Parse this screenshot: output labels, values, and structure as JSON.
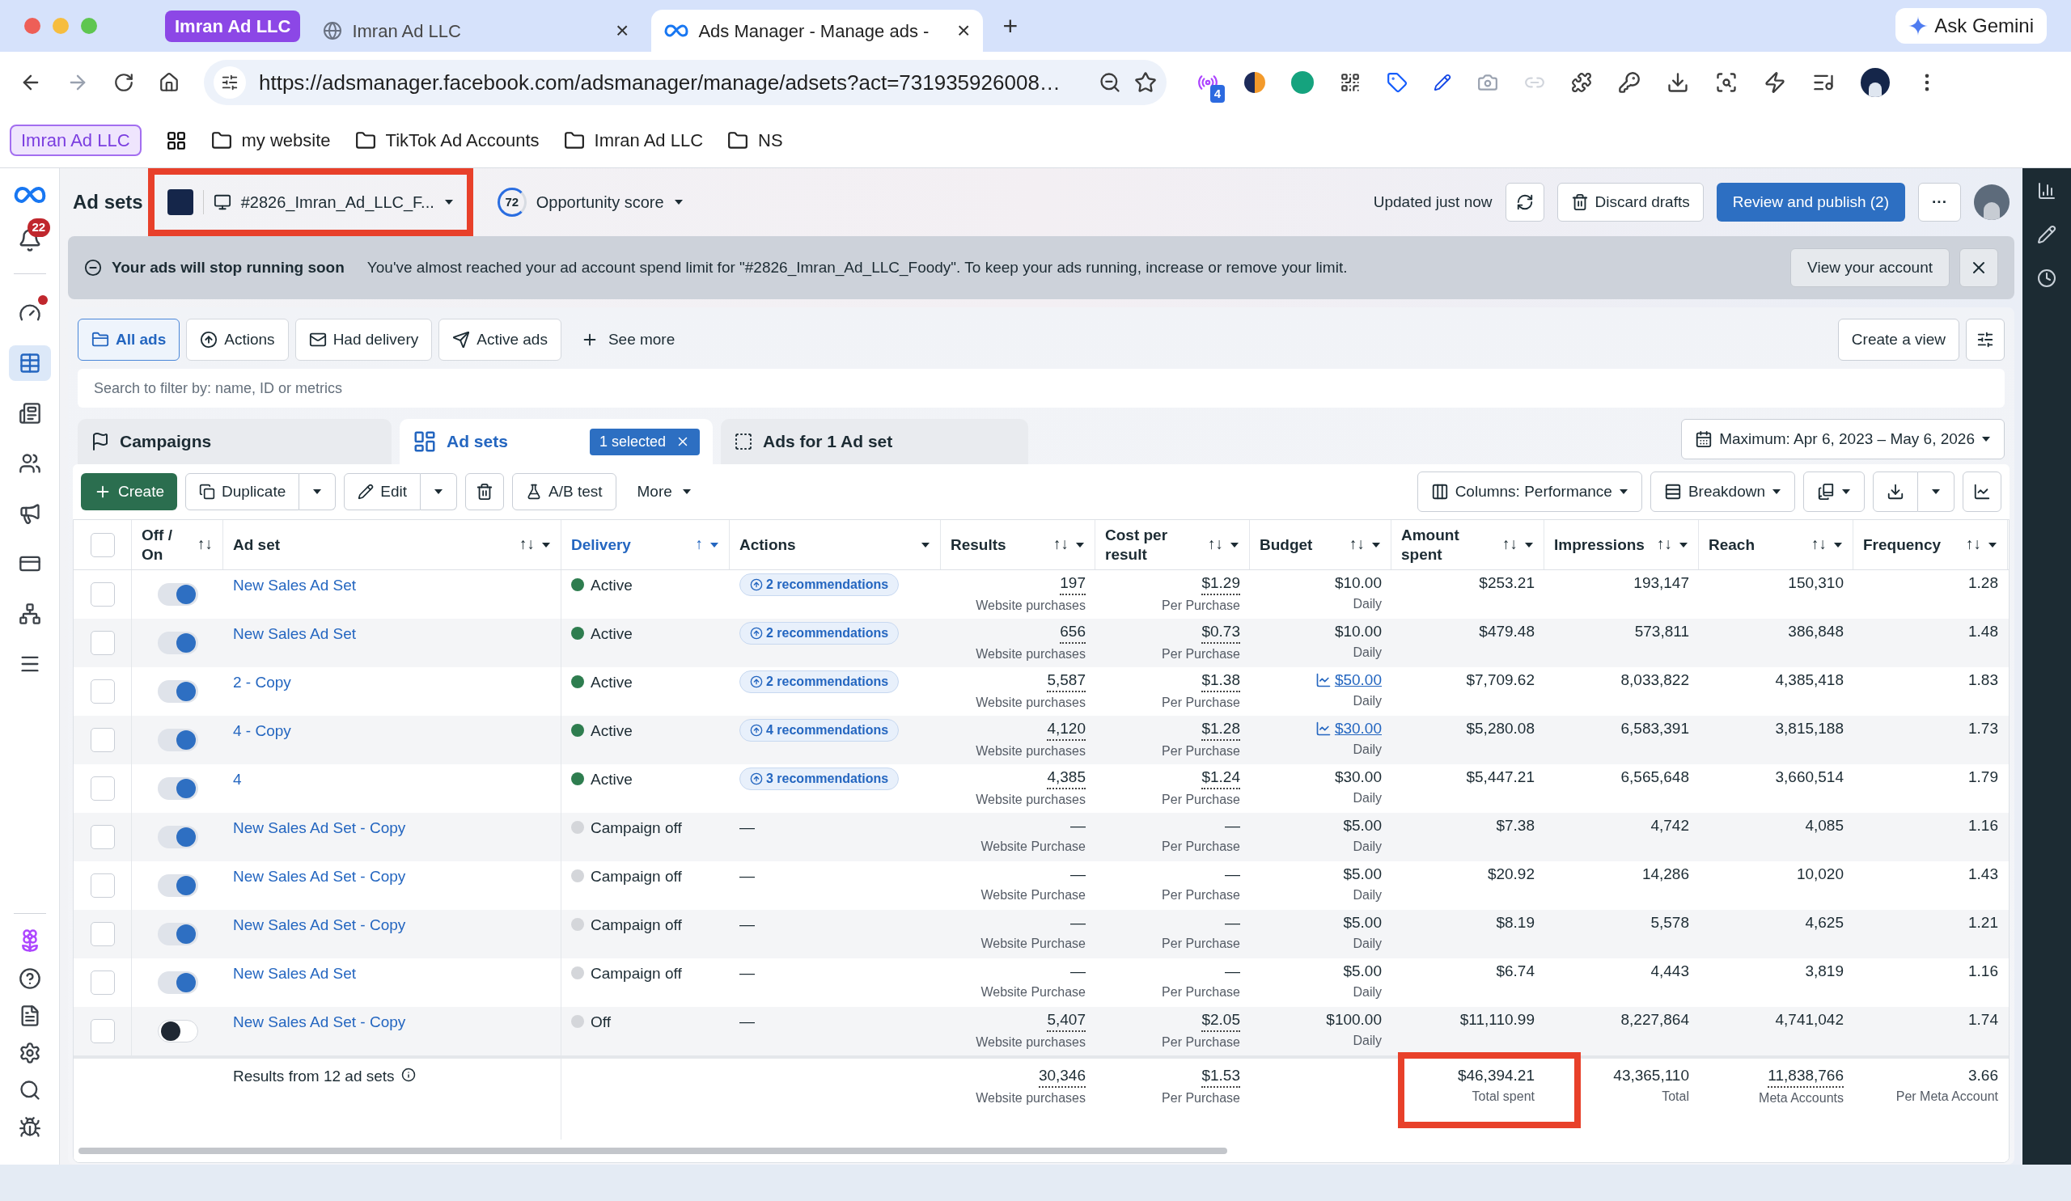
{
  "browser": {
    "tabs": [
      {
        "kind": "group",
        "label": "Imran Ad LLC"
      },
      {
        "kind": "page",
        "label": "Imran Ad LLC",
        "selected": false,
        "close": "×"
      },
      {
        "kind": "page",
        "label": "Ads Manager - Manage ads -",
        "selected": true,
        "close": "×"
      }
    ],
    "new_tab": "+",
    "gemini": "Ask Gemini",
    "url": "https://adsmanager.facebook.com/adsmanager/manage/adsets?act=731935926008…",
    "extension_badge": "4",
    "bookmarks": [
      {
        "kind": "group",
        "label": "Imran Ad LLC"
      },
      {
        "kind": "apps"
      },
      {
        "kind": "folder",
        "label": "my website"
      },
      {
        "kind": "folder",
        "label": "TikTok Ad Accounts"
      },
      {
        "kind": "folder",
        "label": "Imran Ad LLC"
      },
      {
        "kind": "folder",
        "label": "NS"
      }
    ]
  },
  "sidebar": {
    "notifications": "22",
    "items": [
      {
        "selected": false,
        "alert": true
      },
      {
        "selected": true,
        "alert": false
      },
      {
        "selected": false,
        "alert": false
      },
      {
        "selected": false,
        "alert": false
      },
      {
        "selected": false,
        "alert": false
      },
      {
        "selected": false,
        "alert": false
      },
      {
        "selected": false,
        "alert": false
      },
      {
        "selected": false,
        "alert": false
      }
    ]
  },
  "header": {
    "title": "Ad sets",
    "account": {
      "label": "#2826_Imran_Ad_LLC_F...",
      "highlighted": true
    },
    "score": "72",
    "score_label": "Opportunity score",
    "updated": "Updated just now",
    "discard": "Discard drafts",
    "publish": "Review and publish (2)",
    "more": "···"
  },
  "banner": {
    "title": "Your ads will stop running soon",
    "text": "You've almost reached your ad account spend limit for \"#2826_Imran_Ad_LLC_Foody\". To keep your ads running, increase or remove your limit.",
    "button": "View your account"
  },
  "filters": [
    {
      "label": "All ads",
      "selected": true
    },
    {
      "label": "Actions",
      "selected": false
    },
    {
      "label": "Had delivery",
      "selected": false
    },
    {
      "label": "Active ads",
      "selected": false
    }
  ],
  "see_more": "See more",
  "create_view": "Create a view",
  "search": {
    "placeholder": "Search to filter by: name, ID or metrics"
  },
  "levels": [
    {
      "label": "Campaigns",
      "selected": false
    },
    {
      "label": "Ad sets",
      "selected": true,
      "badge": "1 selected"
    },
    {
      "label": "Ads for 1 Ad set",
      "selected": false
    }
  ],
  "date_range": "Maximum: Apr 6, 2023 – May 6, 2026",
  "toolbar": {
    "create": "Create",
    "duplicate": "Duplicate",
    "edit": "Edit",
    "ab_test": "A/B test",
    "more": "More",
    "columns": "Columns: Performance",
    "breakdown": "Breakdown"
  },
  "table": {
    "all_checked": false,
    "columns": [
      {
        "label": "Off / On",
        "sort": "↑↓",
        "menu": false,
        "active": false
      },
      {
        "label": "Ad set",
        "sort": "↑↓",
        "menu": true,
        "active": false
      },
      {
        "label": "Delivery",
        "sort": "↑",
        "menu": true,
        "active": true
      },
      {
        "label": "Actions",
        "menu": true,
        "active": false
      },
      {
        "label": "Results",
        "sort": "↑↓",
        "menu": true,
        "active": false
      },
      {
        "label": "Cost per result",
        "sort": "↑↓",
        "menu": true,
        "active": false
      },
      {
        "label": "Budget",
        "sort": "↑↓",
        "menu": true,
        "active": false
      },
      {
        "label": "Amount spent",
        "sort": "↑↓",
        "menu": true,
        "active": false
      },
      {
        "label": "Impressions",
        "sort": "↑↓",
        "menu": true,
        "active": false
      },
      {
        "label": "Reach",
        "sort": "↑↓",
        "menu": true,
        "active": false
      },
      {
        "label": "Frequency",
        "sort": "↑↓",
        "menu": true,
        "active": false
      }
    ],
    "rows": [
      {
        "checked": false,
        "on": true,
        "name": "New Sales Ad Set",
        "delivery": "Active",
        "color": "#2e7d4f",
        "action": "2 recommendations",
        "results": "197",
        "results_label": "Website purchases",
        "cost": "$1.29",
        "cost_label": "Per Purchase",
        "budget": "$10.00",
        "budget_linked": false,
        "budget_label": "Daily",
        "spent": "$253.21",
        "impressions": "193,147",
        "reach": "150,310",
        "frequency": "1.28"
      },
      {
        "checked": false,
        "on": true,
        "name": "New Sales Ad Set",
        "delivery": "Active",
        "color": "#2e7d4f",
        "action": "2 recommendations",
        "results": "656",
        "results_label": "Website purchases",
        "cost": "$0.73",
        "cost_label": "Per Purchase",
        "budget": "$10.00",
        "budget_linked": false,
        "budget_label": "Daily",
        "spent": "$479.48",
        "impressions": "573,811",
        "reach": "386,848",
        "frequency": "1.48"
      },
      {
        "checked": false,
        "on": true,
        "name": "2 - Copy",
        "delivery": "Active",
        "color": "#2e7d4f",
        "action": "2 recommendations",
        "results": "5,587",
        "results_label": "Website purchases",
        "cost": "$1.38",
        "cost_label": "Per Purchase",
        "budget": "$50.00",
        "budget_linked": true,
        "budget_label": "Daily",
        "spent": "$7,709.62",
        "impressions": "8,033,822",
        "reach": "4,385,418",
        "frequency": "1.83"
      },
      {
        "checked": false,
        "on": true,
        "name": "4 - Copy",
        "delivery": "Active",
        "color": "#2e7d4f",
        "action": "4 recommendations",
        "results": "4,120",
        "results_label": "Website purchases",
        "cost": "$1.28",
        "cost_label": "Per Purchase",
        "budget": "$30.00",
        "budget_linked": true,
        "budget_label": "Daily",
        "spent": "$5,280.08",
        "impressions": "6,583,391",
        "reach": "3,815,188",
        "frequency": "1.73"
      },
      {
        "checked": false,
        "on": true,
        "name": "4",
        "delivery": "Active",
        "color": "#2e7d4f",
        "action": "3 recommendations",
        "results": "4,385",
        "results_label": "Website purchases",
        "cost": "$1.24",
        "cost_label": "Per Purchase",
        "budget": "$30.00",
        "budget_linked": false,
        "budget_label": "Daily",
        "spent": "$5,447.21",
        "impressions": "6,565,648",
        "reach": "3,660,514",
        "frequency": "1.79"
      },
      {
        "checked": false,
        "on": true,
        "name": "New Sales Ad Set - Copy",
        "delivery": "Campaign off",
        "color": "#d4d6da",
        "action": "—",
        "results": "—",
        "results_label": "Website Purchase",
        "cost": "—",
        "cost_label": "Per Purchase",
        "budget": "$5.00",
        "budget_linked": false,
        "budget_label": "Daily",
        "spent": "$7.38",
        "impressions": "4,742",
        "reach": "4,085",
        "frequency": "1.16"
      },
      {
        "checked": false,
        "on": true,
        "name": "New Sales Ad Set - Copy",
        "delivery": "Campaign off",
        "color": "#d4d6da",
        "action": "—",
        "results": "—",
        "results_label": "Website Purchase",
        "cost": "—",
        "cost_label": "Per Purchase",
        "budget": "$5.00",
        "budget_linked": false,
        "budget_label": "Daily",
        "spent": "$20.92",
        "impressions": "14,286",
        "reach": "10,020",
        "frequency": "1.43"
      },
      {
        "checked": false,
        "on": true,
        "name": "New Sales Ad Set - Copy",
        "delivery": "Campaign off",
        "color": "#d4d6da",
        "action": "—",
        "results": "—",
        "results_label": "Website Purchase",
        "cost": "—",
        "cost_label": "Per Purchase",
        "budget": "$5.00",
        "budget_linked": false,
        "budget_label": "Daily",
        "spent": "$8.19",
        "impressions": "5,578",
        "reach": "4,625",
        "frequency": "1.21"
      },
      {
        "checked": false,
        "on": true,
        "name": "New Sales Ad Set",
        "delivery": "Campaign off",
        "color": "#d4d6da",
        "action": "—",
        "results": "—",
        "results_label": "Website Purchase",
        "cost": "—",
        "cost_label": "Per Purchase",
        "budget": "$5.00",
        "budget_linked": false,
        "budget_label": "Daily",
        "spent": "$6.74",
        "impressions": "4,443",
        "reach": "3,819",
        "frequency": "1.16"
      },
      {
        "checked": false,
        "on": false,
        "name": "New Sales Ad Set - Copy",
        "delivery": "Off",
        "color": "#d4d6da",
        "action": "—",
        "results": "5,407",
        "results_label": "Website purchases",
        "cost": "$2.05",
        "cost_label": "Per Purchase",
        "budget": "$100.00",
        "budget_linked": false,
        "budget_label": "Daily",
        "spent": "$11,110.99",
        "impressions": "8,227,864",
        "reach": "4,741,042",
        "frequency": "1.74"
      }
    ],
    "footer": {
      "label": "Results from 12 ad sets",
      "results": "30,346",
      "results_label": "Website purchases",
      "cost": "$1.53",
      "cost_label": "Per Purchase",
      "spent": "$46,394.21",
      "spent_label": "Total spent",
      "spent_highlighted": true,
      "impressions": "43,365,110",
      "impressions_label": "Total",
      "reach": "11,838,766",
      "reach_label": "Meta Accounts",
      "frequency": "3.66",
      "frequency_label": "Per Meta Account"
    }
  }
}
